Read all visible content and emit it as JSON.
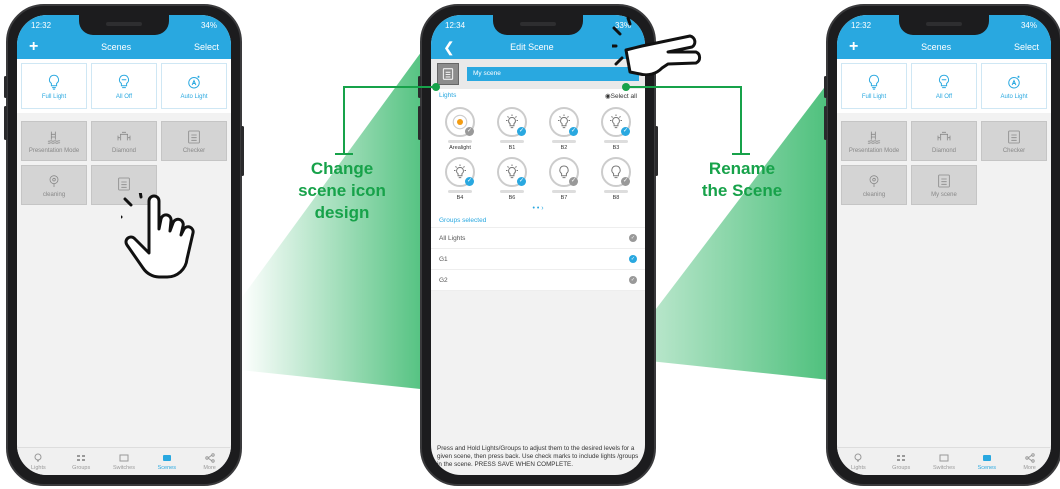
{
  "colors": {
    "brand": "#29a8e0",
    "annotation": "#17a24a",
    "beam": "#2eb565"
  },
  "phones": {
    "left": {
      "time": "12:32",
      "battery": "34%",
      "header": {
        "title": "Scenes",
        "action": "Select",
        "plus_icon": "plus-icon"
      },
      "top_tiles": [
        "Full Light",
        "All Off",
        "Auto Light"
      ],
      "scenes": [
        "Presentation Mode",
        "Diamond",
        "Checker",
        "cleaning",
        ""
      ]
    },
    "middle": {
      "time": "12:34",
      "battery": "33%",
      "header": {
        "title": "Edit Scene",
        "back_icon": "chevron-left-icon"
      },
      "scene_name": "My scene",
      "lights_label": "Lights",
      "select_all": "Select all",
      "lights": [
        {
          "name": "Arealight",
          "check": "gray"
        },
        {
          "name": "B1",
          "check": "blue"
        },
        {
          "name": "B2",
          "check": "blue"
        },
        {
          "name": "B3",
          "check": "blue"
        },
        {
          "name": "B4",
          "check": "blue"
        },
        {
          "name": "B6",
          "check": "blue"
        },
        {
          "name": "B7",
          "check": "gray"
        },
        {
          "name": "B8",
          "check": "gray"
        }
      ],
      "pager": "• • ›",
      "groups_label": "Groups selected",
      "groups": [
        {
          "name": "All Lights",
          "check": "gray"
        },
        {
          "name": "G1",
          "check": "blue"
        },
        {
          "name": "G2",
          "check": "gray"
        }
      ],
      "hint": "Press and Hold Lights/Groups to adjust them to the desired levels for a given scene, then press back. Use check marks to include lights /groups in the scene. PRESS SAVE WHEN COMPLETE."
    },
    "right": {
      "time": "12:32",
      "battery": "34%",
      "header": {
        "title": "Scenes",
        "action": "Select",
        "plus_icon": "plus-icon"
      },
      "top_tiles": [
        "Full Light",
        "All Off",
        "Auto Light"
      ],
      "scenes": [
        "Presentation Mode",
        "Diamond",
        "Checker",
        "cleaning",
        "My scene"
      ]
    }
  },
  "nav": [
    "Lights",
    "Groups",
    "Switches",
    "Scenes",
    "More"
  ],
  "annotations": {
    "left": [
      "Change",
      "scene icon",
      "design"
    ],
    "right": [
      "Rename",
      "the Scene"
    ]
  }
}
